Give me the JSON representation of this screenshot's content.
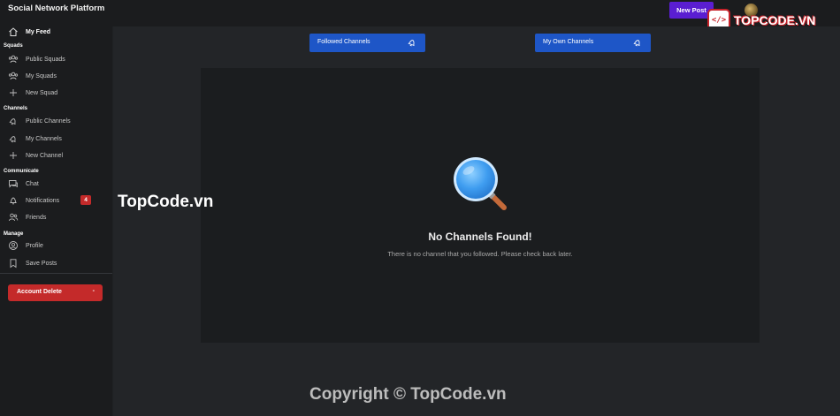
{
  "app": {
    "title": "Social Network Platform"
  },
  "header": {
    "new_post_label": "New Post"
  },
  "logo": {
    "badge_text": "</>",
    "text": "TOPCODE.VN"
  },
  "sidebar": {
    "my_feed": "My Feed",
    "sections": {
      "squads": "Squads",
      "channels": "Channels",
      "communicate": "Communicate",
      "manage": "Manage"
    },
    "items": {
      "public_squads": "Public Squads",
      "my_squads": "My Squads",
      "new_squad": "New Squad",
      "public_channels": "Public Channels",
      "my_channels": "My Channels",
      "new_channel": "New Channel",
      "chat": "Chat",
      "notifications": "Notifications",
      "notifications_count": "4",
      "friends": "Friends",
      "profile": "Profile",
      "save_posts": "Save Posts"
    },
    "account_delete": "Account Delete",
    "account_delete_symbol": "-"
  },
  "tabs": {
    "followed": "Followed Channels",
    "own": "My Own Channels"
  },
  "empty_state": {
    "title": "No Channels Found!",
    "message": "There is no channel that you followed. Please check back later."
  },
  "watermarks": {
    "middle": "TopCode.vn",
    "copyright": "Copyright © TopCode.vn"
  },
  "colors": {
    "accent_purple": "#5a1ed1",
    "tab_blue": "#1e56c7",
    "danger_red": "#c42a2a",
    "magnifier_blue": "#4aa8f5"
  }
}
